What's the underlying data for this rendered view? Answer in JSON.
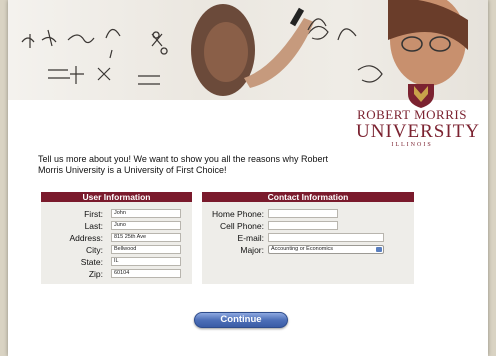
{
  "brand": {
    "line1": "ROBERT MORRIS",
    "line2": "UNIVERSITY",
    "line3": "ILLINOIS"
  },
  "intro": "Tell us more about you! We want to show you all the reasons why Robert Morris University is a University of First Choice!",
  "user_info": {
    "title": "User Information",
    "fields": [
      {
        "label": "First:",
        "value": "John"
      },
      {
        "label": "Last:",
        "value": "Juno"
      },
      {
        "label": "Address:",
        "value": "815 25th Ave"
      },
      {
        "label": "City:",
        "value": "Bellwood"
      },
      {
        "label": "State:",
        "value": "IL"
      },
      {
        "label": "Zip:",
        "value": "60104"
      }
    ]
  },
  "contact_info": {
    "title": "Contact Information",
    "home_phone_label": "Home Phone:",
    "cell_phone_label": "Cell Phone:",
    "email_label": "E-mail:",
    "major_label": "Major:",
    "major_value": "Accounting or Economics"
  },
  "continue_label": "Continue",
  "colors": {
    "maroon": "#7a1a2c",
    "button_blue": "#4d6fb8"
  }
}
